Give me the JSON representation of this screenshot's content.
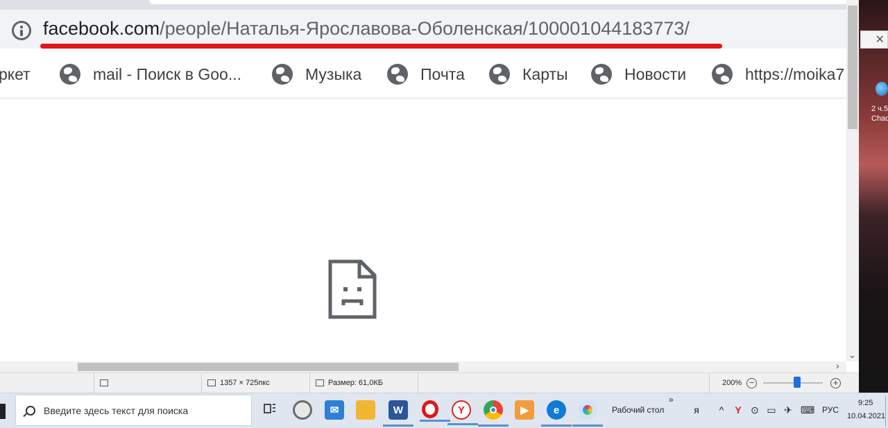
{
  "browser": {
    "url_host": "facebook.com",
    "url_path": "/people/Наталья-Ярославова-Оболенская/100001044183773/",
    "bookmarks": [
      {
        "label": "ркет",
        "has_icon": false
      },
      {
        "label": "mail - Поиск в Goo...",
        "has_icon": true
      },
      {
        "label": "Музыка",
        "has_icon": true
      },
      {
        "label": "Почта",
        "has_icon": true
      },
      {
        "label": "Карты",
        "has_icon": true
      },
      {
        "label": "Новости",
        "has_icon": true
      },
      {
        "label": "https://moika7",
        "has_icon": true
      }
    ]
  },
  "desktop": {
    "icon_label_line1": "2 ч.5",
    "icon_label_line2": "Chad"
  },
  "status_bar": {
    "dimensions": "1357 × 725пкс",
    "size": "Размер: 61,0КБ",
    "zoom": "200%",
    "zoom_level_percent": 200
  },
  "taskbar": {
    "search_placeholder": "Введите здесь текст для поиска",
    "desktop_label": "Рабочий стол",
    "chevron": "»",
    "language": "РУС",
    "time": "9:25",
    "date": "10.04.2021",
    "apps": [
      {
        "name": "task-view",
        "color": "#333333"
      },
      {
        "name": "circle-app",
        "color": "#6a6a6a"
      },
      {
        "name": "mail",
        "color": "#2f7fd6"
      },
      {
        "name": "file-explorer",
        "color": "#f2b632"
      },
      {
        "name": "word",
        "color": "#2b579a"
      },
      {
        "name": "opera",
        "color": "#e0161a"
      },
      {
        "name": "yandex-browser",
        "color": "#e02020"
      },
      {
        "name": "chrome",
        "color": "#4285f4"
      },
      {
        "name": "media-player",
        "color": "#f39c3d"
      },
      {
        "name": "edge",
        "color": "#0f7bd4"
      },
      {
        "name": "paint",
        "color": "#7bb3e0"
      }
    ]
  },
  "colors": {
    "underline": "#e0161a",
    "omnibox_bg": "#f1f3f4",
    "taskbar_bg": "#dfe6ef"
  }
}
